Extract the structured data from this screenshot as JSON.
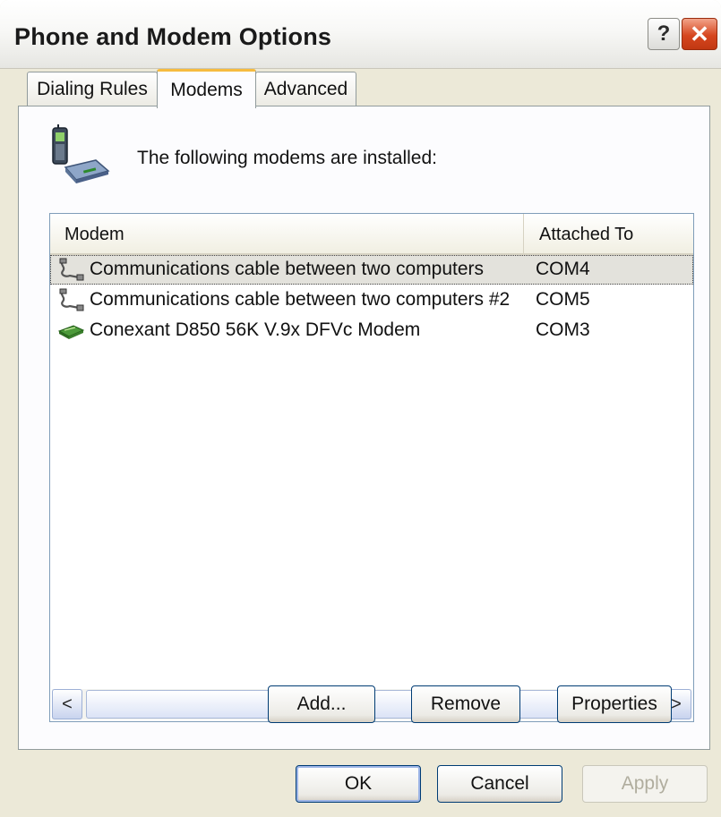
{
  "window": {
    "title": "Phone and Modem Options",
    "help_label": "?",
    "close_label": "✕"
  },
  "tabs": [
    {
      "label": "Dialing Rules",
      "active": false
    },
    {
      "label": "Modems",
      "active": true
    },
    {
      "label": "Advanced",
      "active": false
    }
  ],
  "modems_tab": {
    "intro_text": "The following modems are  installed:",
    "header_icon": "phone-modem-icon",
    "columns": [
      "Modem",
      "Attached To"
    ],
    "rows": [
      {
        "name": "Communications cable between two computers",
        "port": "COM4",
        "icon": "cable-icon",
        "selected": true
      },
      {
        "name": "Communications cable between two computers #2",
        "port": "COM5",
        "icon": "cable-icon",
        "selected": false
      },
      {
        "name": "Conexant D850 56K V.9x DFVc Modem",
        "port": "COM3",
        "icon": "modem-icon",
        "selected": false
      }
    ],
    "scroll_left": "<",
    "scroll_right": ">",
    "scroll_grip": "IIII",
    "buttons": {
      "add": "Add...",
      "remove": "Remove",
      "properties": "Properties"
    }
  },
  "footer": {
    "ok": "OK",
    "cancel": "Cancel",
    "apply": "Apply"
  },
  "colors": {
    "window_bg": "#ece9d8",
    "selection_bg": "#e3e2dc",
    "active_tab_accent": "#f6bb3f",
    "close_button": "#d6461f"
  }
}
